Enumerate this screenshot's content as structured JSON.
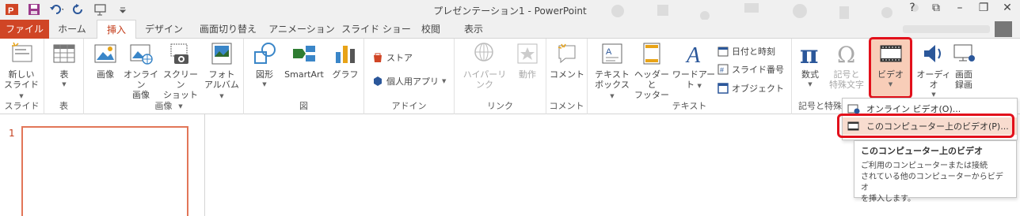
{
  "window": {
    "title": "プレゼンテーション1 - PowerPoint",
    "help": "?",
    "controls": [
      "⧉",
      "–",
      "❐",
      "✕"
    ]
  },
  "qat": {
    "icons": [
      "powerpoint-logo-icon",
      "save-icon",
      "undo-icon",
      "redo-icon",
      "start-slideshow-icon",
      "customize-qat-icon"
    ]
  },
  "tabs": [
    {
      "label": "ファイル"
    },
    {
      "label": "ホーム"
    },
    {
      "label": "挿入"
    },
    {
      "label": "デザイン"
    },
    {
      "label": "画面切り替え"
    },
    {
      "label": "アニメーション"
    },
    {
      "label": "スライド ショー"
    },
    {
      "label": "校閲"
    },
    {
      "label": "表示"
    }
  ],
  "ribbon": {
    "groups": {
      "slides": "スライド",
      "tables": "表",
      "images": "画像",
      "illustrations": "図",
      "addins": "アドイン",
      "links": "リンク",
      "comments": "コメント",
      "text": "テキスト",
      "symbols": "記号と特殊"
    },
    "new_slide": [
      "新しい",
      "スライド"
    ],
    "table": "表",
    "picture": "画像",
    "online_pictures": [
      "オンライン",
      "画像"
    ],
    "screenshot": [
      "スクリーン",
      "ショット"
    ],
    "photo_album": [
      "フォト",
      "アルバム"
    ],
    "shapes": "図形",
    "smartart": "SmartArt",
    "chart": "グラフ",
    "store": "ストア",
    "my_apps": "個人用アプリ",
    "hyperlink": "ハイパーリンク",
    "action": "動作",
    "comment": "コメント",
    "textbox": [
      "テキスト",
      "ボックス"
    ],
    "header_footer": [
      "ヘッダーと",
      "フッター"
    ],
    "wordart": "ワードアート",
    "date_time": "日付と時刻",
    "slide_number": "スライド番号",
    "object": "オブジェクト",
    "equation": "数式",
    "symbol": [
      "記号と",
      "特殊文字"
    ],
    "video": "ビデオ",
    "audio": "オーディオ",
    "screen_recording": [
      "画面",
      "録画"
    ]
  },
  "dropdown": {
    "online_video": "オンライン ビデオ(O)...",
    "video_on_pc": "このコンピューター上のビデオ(P)..."
  },
  "tooltip": {
    "title": "このコンピューター上のビデオ",
    "body": [
      "ご利用のコンピューターまたは接続",
      "されている他のコンピューターからビデオ",
      "を挿入します。"
    ]
  },
  "slides": [
    {
      "number": "1"
    }
  ],
  "colors": {
    "file_tab": "#d04525",
    "accent": "#c43e1c",
    "highlight": "#e2101b",
    "video_selected": "#f8cdb8"
  }
}
